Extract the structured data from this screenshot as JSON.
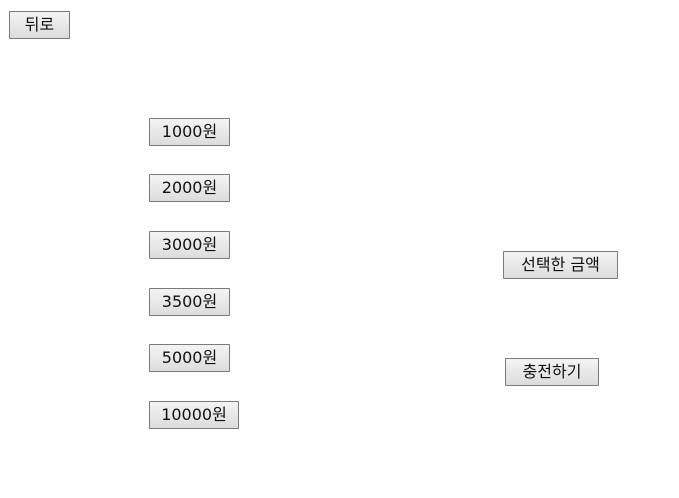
{
  "nav": {
    "back_label": "뒤로"
  },
  "amounts": [
    {
      "label": "1000원"
    },
    {
      "label": "2000원"
    },
    {
      "label": "3000원"
    },
    {
      "label": "3500원"
    },
    {
      "label": "5000원"
    },
    {
      "label": "10000원"
    }
  ],
  "panel": {
    "selected_amount_label": "선택한 금액",
    "charge_label": "충전하기"
  }
}
